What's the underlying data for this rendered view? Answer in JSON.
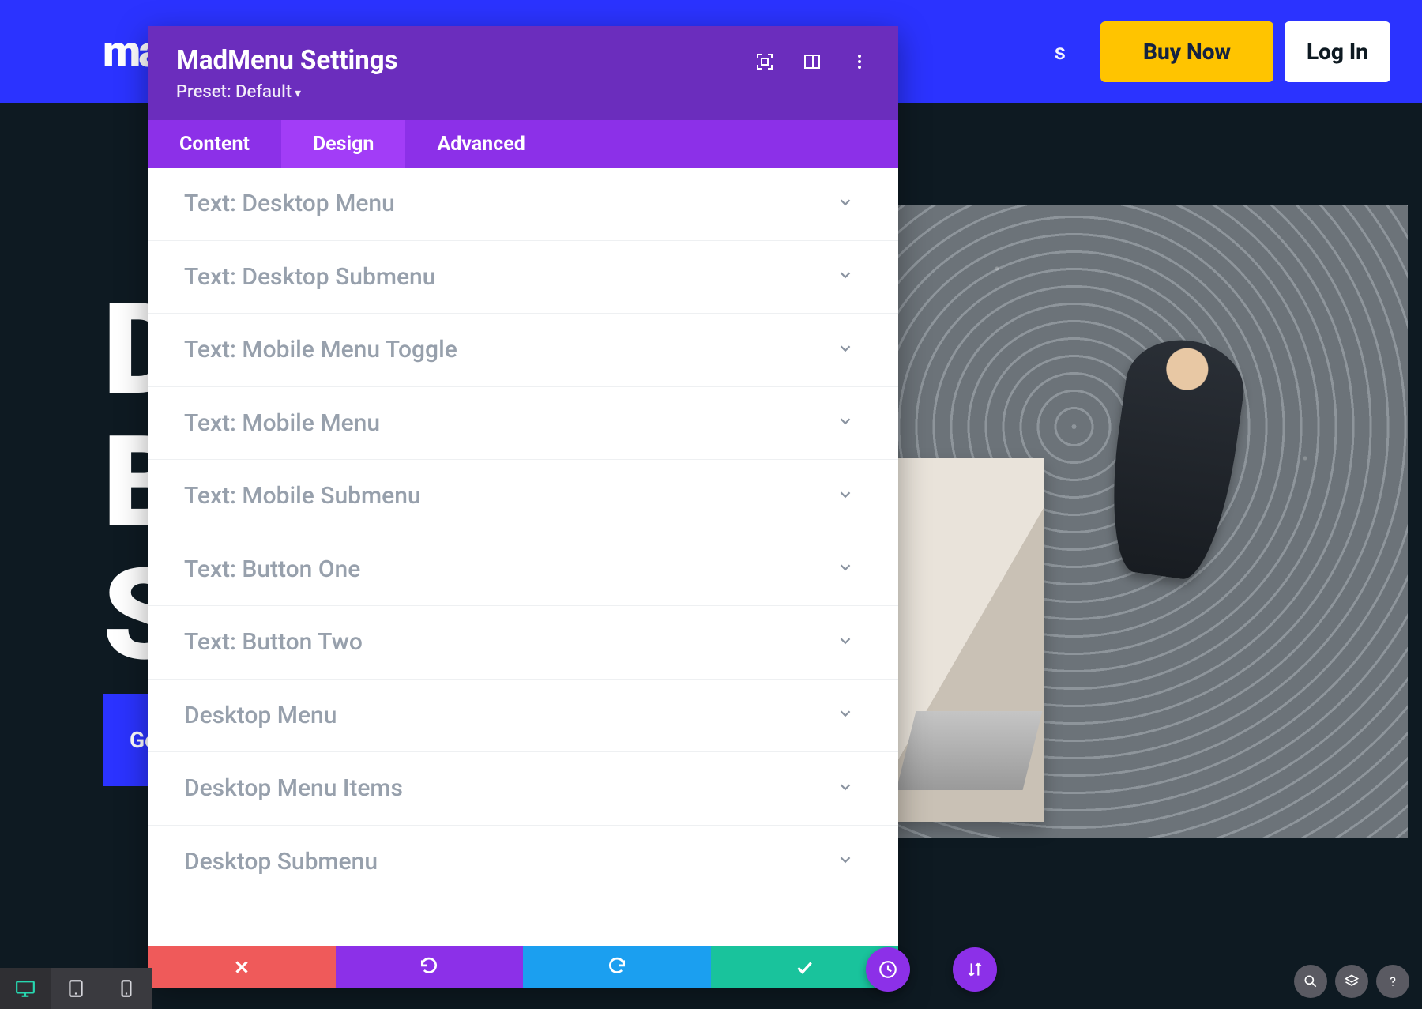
{
  "header": {
    "logo_text": "ma",
    "nav_fragment": "s",
    "buy_label": "Buy Now",
    "login_label": "Log In"
  },
  "hero": {
    "line1": "D",
    "line2": "B",
    "line3": "S",
    "cta_label": "Get"
  },
  "panel": {
    "title": "MadMenu Settings",
    "preset_label": "Preset: Default",
    "tabs": [
      {
        "label": "Content",
        "active": false
      },
      {
        "label": "Design",
        "active": true
      },
      {
        "label": "Advanced",
        "active": false
      }
    ],
    "sections": [
      "Text: Desktop Menu",
      "Text: Desktop Submenu",
      "Text: Mobile Menu Toggle",
      "Text: Mobile Menu",
      "Text: Mobile Submenu",
      "Text: Button One",
      "Text: Button Two",
      "Desktop Menu",
      "Desktop Menu Items",
      "Desktop Submenu"
    ]
  },
  "colors": {
    "header": "#2b33ff",
    "panel_head": "#6b2dbd",
    "tabs_bg": "#8c30e8",
    "tab_active": "#a23df7",
    "save": "#19c39c",
    "redo": "#1b9ff0",
    "undo": "#8c30e8",
    "cancel": "#ef5a5a",
    "buy": "#ffc400"
  }
}
